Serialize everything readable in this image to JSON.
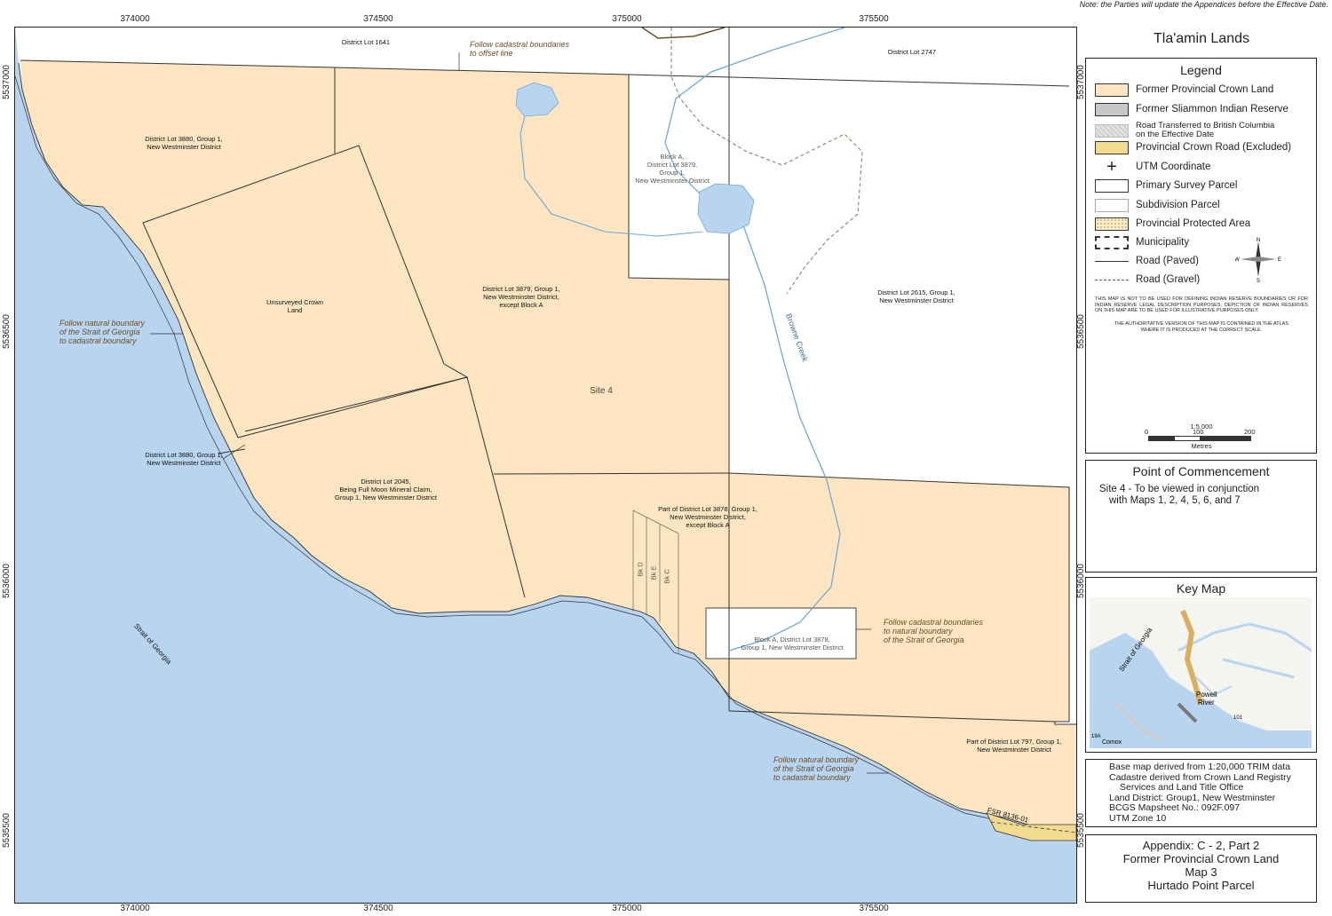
{
  "note": "Note:  the Parties will update the Appendices before the Effective Date.",
  "axes": {
    "x_ticks": [
      "374000",
      "374500",
      "375000",
      "375500"
    ],
    "y_ticks": [
      "5537000",
      "5536500",
      "5536000",
      "5535500"
    ]
  },
  "map_labels": {
    "dl1641": "District Lot 1641",
    "dl2747": "District Lot 2747",
    "dl3880_top_1": "District Lot 3880, Group 1,",
    "dl3880_top_2": "New Westminster District",
    "blockA_1": "Block A,",
    "blockA_2": "District Lot 3879,",
    "blockA_3": "Group 1,",
    "blockA_4": "New Westminster District",
    "unsurveyed_1": "Unsurveyed Crown",
    "unsurveyed_2": "Land",
    "dl3879_1": "District Lot 3879, Group 1,",
    "dl3879_2": "New Westminster District,",
    "dl3879_3": "except Block A",
    "dl2615_1": "District Lot 2615, Group 1,",
    "dl2615_2": "New Westminster District",
    "site4": "Site 4",
    "browne_creek": "Browne Creek",
    "dl3880_bot_1": "District Lot 3880, Group 1,",
    "dl3880_bot_2": "New Westminster District",
    "dl2045_1": "District Lot 2045,",
    "dl2045_2": "Being Full Moon Mineral Claim,",
    "dl2045_3": "Group 1, New Westminster District",
    "dl3878_1": "Part of District Lot 3878, Group 1,",
    "dl3878_2": "New Westminster District,",
    "dl3878_3": "except Block A",
    "bkD": "Bk D",
    "bkE": "Bk E",
    "bkC": "Bk C",
    "blockA3878_1": "Block A, District Lot 3878,",
    "blockA3878_2": "Group 1, New Westminster District",
    "dl797_1": "Part of District Lot 797, Group 1,",
    "dl797_2": "New Westminster District",
    "strait": "Strait of Georgia",
    "fsr": "FSR 8136-01",
    "note_top_1": "Follow cadastral boundaries",
    "note_top_2": "to offset line",
    "note_left_1": "Follow natural boundary",
    "note_left_2": "of the Strait of Georgia",
    "note_left_3": "to cadastral boundary",
    "note_right_1": "Follow cadastral boundaries",
    "note_right_2": "to natural boundary",
    "note_right_3": "of the Strait of Georgia",
    "note_bottom_1": "Follow natural boundary",
    "note_bottom_2": "of the Strait of Georgia",
    "note_bottom_3": "to cadastral boundary"
  },
  "title": "Tla'amin Lands",
  "legend": {
    "title": "Legend",
    "items": [
      {
        "label": "Former Provincial Crown Land",
        "color": "#fce5c0",
        "icon": "fill-swatch"
      },
      {
        "label": "Former Sliammon Indian Reserve",
        "color": "#c9c7c7",
        "icon": "fill-swatch"
      },
      {
        "label": "Road Transferred to British Columbia",
        "label2": "on the Effective Date",
        "color": "#e6e6e6",
        "icon": "hatch-swatch"
      },
      {
        "label": "Provincial Crown Road (Excluded)",
        "color": "#f1db8e",
        "icon": "fill-swatch"
      },
      {
        "label": "UTM Coordinate",
        "icon": "plus-icon"
      },
      {
        "label": "Primary Survey Parcel",
        "color": "#ffffff",
        "icon": "fill-swatch"
      },
      {
        "label": "Subdivision Parcel",
        "color": "#ffffff",
        "icon": "thin-swatch"
      },
      {
        "label": "Provincial Protected Area",
        "color": "#f7ecc5",
        "icon": "dotted-swatch"
      },
      {
        "label": "Municipality",
        "icon": "dashed-box"
      },
      {
        "label": "Road (Paved)",
        "icon": "solid-line"
      },
      {
        "label": "Road (Gravel)",
        "icon": "dashed-line"
      }
    ],
    "disclaimer1": "THIS MAP IS NOT TO BE USED FOR DEFINING INDIAN RESERVE BOUNDARIES OR FOR INDIAN RESERVE LEGAL DESCRIPTION PURPOSES. DEPICTION OF INDIAN RESERVES ON THIS MAP ARE TO BE USED FOR ILLUSTRATIVE PURPOSES ONLY.",
    "disclaimer2": "THE AUTHORITATIVE VERSION OF THIS MAP IS CONTAINED IN THE ATLAS WHERE IT IS PRODUCED AT THE CORRECT SCALE.",
    "compass": {
      "n": "N",
      "s": "S",
      "e": "E",
      "w": "W"
    },
    "scale": {
      "ratio": "1:5,000",
      "t0": "0",
      "t1": "100",
      "t2": "200",
      "unit": "Metres"
    }
  },
  "commencement": {
    "title": "Point of Commencement",
    "line1": "Site 4 - To be viewed in conjunction",
    "line2": "with Maps 1, 2, 4, 5, 6, and 7"
  },
  "keymap": {
    "title": "Key Map",
    "strait": "Strait of Georgia",
    "powell": "Powell",
    "river": "River",
    "comox": "Comox",
    "hwy101": "101",
    "hwy19a": "19A"
  },
  "source": {
    "line1": "Base map derived from 1:20,000 TRIM data",
    "line2": "Cadastre derived from Crown Land Registry",
    "line3": "Services and Land Title Office",
    "line4": "Land District: Group1, New Westminster",
    "line5": "BCGS Mapsheet No.: 092F.097",
    "line6": "UTM Zone 10"
  },
  "appendix": {
    "line1": "Appendix:  C - 2, Part 2",
    "line2": "Former Provincial Crown Land",
    "line3": "Map 3",
    "line4": "Hurtado Point Parcel"
  }
}
